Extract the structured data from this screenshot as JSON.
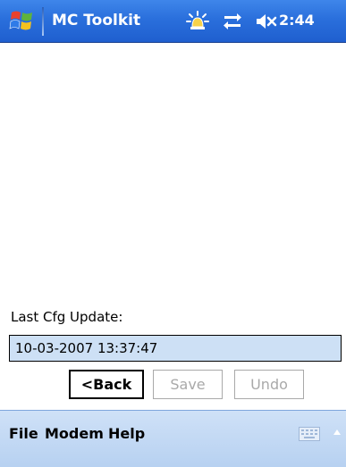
{
  "titlebar": {
    "app_title": "MC Toolkit",
    "clock": "2:44",
    "icons": [
      "windows-start-icon",
      "notification-icon",
      "connectivity-icon",
      "volume-muted-icon"
    ]
  },
  "main": {
    "last_cfg_label": "Last Cfg Update:",
    "last_cfg_value": "10-03-2007 13:37:47",
    "buttons": {
      "back": "<Back",
      "save": "Save",
      "undo": "Undo"
    }
  },
  "menubar": {
    "items": [
      "File",
      "Modem",
      "Help"
    ],
    "input_icon": "keyboard-icon"
  },
  "colors": {
    "titlebar": "#2a6fdc",
    "field_bg": "#cde0f5",
    "menubar": "#c4daf4",
    "disabled_text": "#a9a9a9"
  }
}
